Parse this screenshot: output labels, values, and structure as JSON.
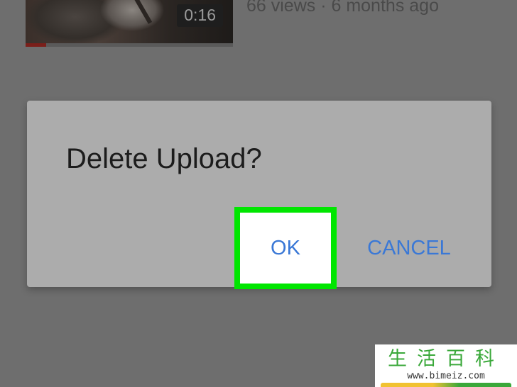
{
  "background_video": {
    "duration": "0:16",
    "meta": "66 views · 6 months ago",
    "progress_watched": 0.1
  },
  "dialog": {
    "title": "Delete Upload?",
    "ok_label": "OK",
    "cancel_label": "CANCEL"
  },
  "watermark": {
    "glyphs": "生活百科",
    "url": "www.bimeiz.com"
  },
  "colors": {
    "highlight": "#00e600",
    "button_text": "#3a78d6",
    "dialog_bg": "#acacac",
    "overlay_bg": "#6e6e6e"
  }
}
